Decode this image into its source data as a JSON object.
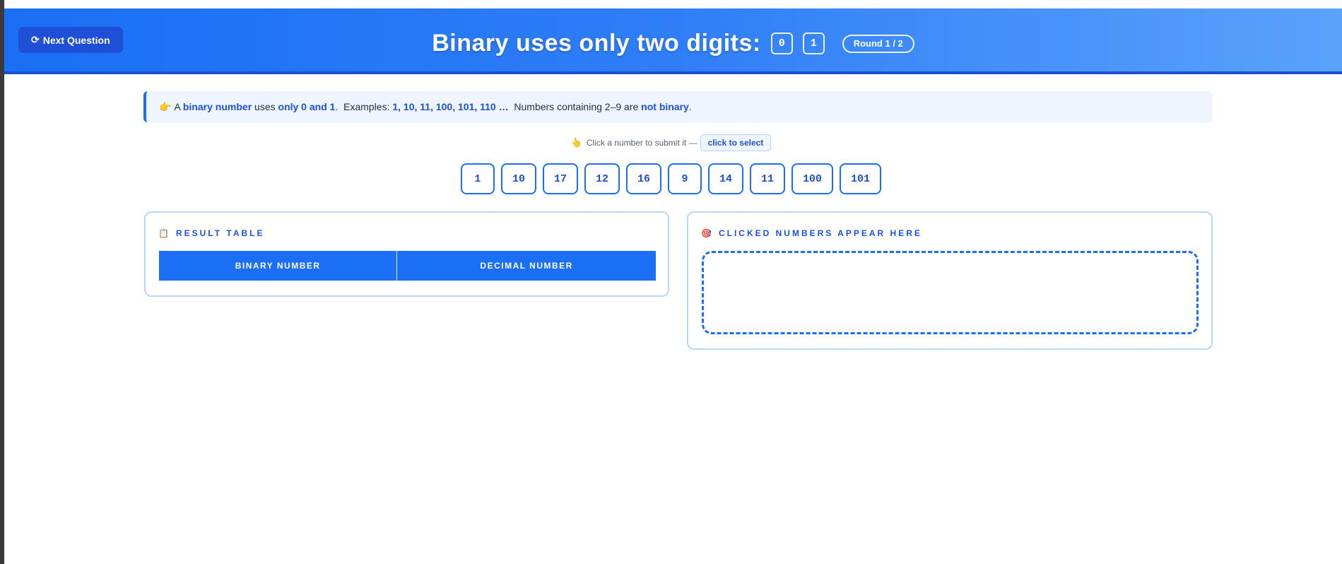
{
  "header": {
    "next_button_label": "Next Question",
    "next_button_icon": "refresh-icon",
    "title": "Binary uses only two digits:",
    "digits": [
      "0",
      "1"
    ],
    "round_label": "Round 1 / 2"
  },
  "info": {
    "icon": "pointing-hand-icon",
    "t1": "A ",
    "b1": "binary number",
    "t2": " uses ",
    "b2": "only 0 and 1",
    "t3": ".  Examples: ",
    "b3": "1, 10, 11, 100, 101, 110 …",
    "t4": "  Numbers containing 2–9 are ",
    "b4": "not binary",
    "t5": "."
  },
  "hint": {
    "icon": "pointing-up-icon",
    "text": "Click a number to submit it —",
    "chip": "click to select"
  },
  "numbers": [
    "1",
    "10",
    "17",
    "12",
    "16",
    "9",
    "14",
    "11",
    "100",
    "101"
  ],
  "result_panel": {
    "icon": "clipboard-icon",
    "title": "RESULT TABLE",
    "columns": [
      "BINARY NUMBER",
      "DECIMAL NUMBER"
    ]
  },
  "clicked_panel": {
    "icon": "target-icon",
    "title": "CLICKED NUMBERS APPEAR HERE"
  },
  "colors": {
    "accent": "#1a6ff5",
    "accent_dark": "#1e4fd6",
    "banner_bg": "#eef5ff"
  }
}
